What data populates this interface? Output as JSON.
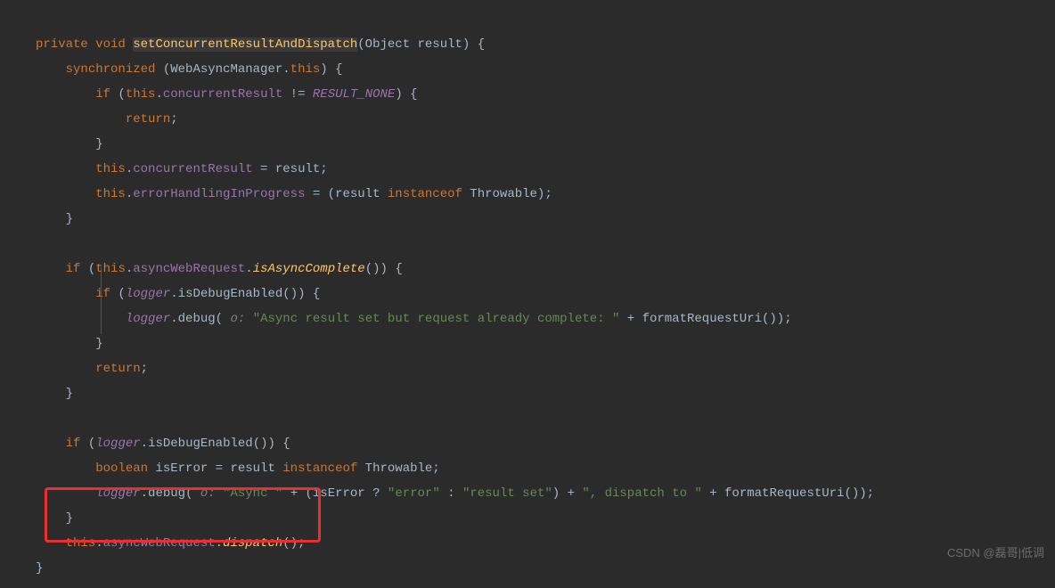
{
  "code": {
    "t1": "private",
    "t2": "void",
    "t3": "setConcurrentResultAndDispatch",
    "t4": "(Object result) {",
    "t5": "synchronized",
    "t6": " (WebAsyncManager.",
    "t7": "this",
    "t8": ") {",
    "t9": "if",
    "t10": " (",
    "t11": "this",
    "t12": ".",
    "t13": "concurrentResult",
    "t14": " != ",
    "t15": "RESULT_NONE",
    "t16": ") {",
    "t17": "return",
    "t18": ";",
    "t19": "}",
    "t20": "this",
    "t21": ".",
    "t22": "concurrentResult",
    "t23": " = result;",
    "t24": "this",
    "t25": ".",
    "t26": "errorHandlingInProgress",
    "t27": " = (result ",
    "t28": "instanceof",
    "t29": " Throwable);",
    "t30": "}",
    "t31": "if",
    "t32": " (",
    "t33": "this",
    "t34": ".",
    "t35": "asyncWebRequest",
    "t36": ".",
    "t37": "isAsyncComplete",
    "t38": "()) {",
    "t39": "if",
    "t40": " (",
    "t41": "logger",
    "t42": ".",
    "t43": "isDebugEnabled",
    "t44": "()) {",
    "t45": "logger",
    "t46": ".",
    "t47": "debug",
    "t48": "(",
    "t49": " o: ",
    "t50": "\"Async result set but request already complete: \"",
    "t51": " + ",
    "t52": "formatRequestUri",
    "t53": "());",
    "t54": "}",
    "t55": "return",
    "t56": ";",
    "t57": "}",
    "t58": "if",
    "t59": " (",
    "t60": "logger",
    "t61": ".",
    "t62": "isDebugEnabled",
    "t63": "()) {",
    "t64": "boolean",
    "t65": " isError = result ",
    "t66": "instanceof",
    "t67": " Throwable;",
    "t68": "logger",
    "t69": ".",
    "t70": "debug",
    "t71": "(",
    "t72": " o: ",
    "t73": "\"Async \"",
    "t74": " + (isError ? ",
    "t75": "\"error\"",
    "t76": " : ",
    "t77": "\"result set\"",
    "t78": ") + ",
    "t79": "\", dispatch to \"",
    "t80": " + ",
    "t81": "formatRequestUri",
    "t82": "());",
    "t83": "}",
    "t84": "this",
    "t85": ".",
    "t86": "asyncWebRequest",
    "t87": ".",
    "t88": "dispatch",
    "t89": "();",
    "t90": "}"
  },
  "watermark": "CSDN @磊哥|低调"
}
